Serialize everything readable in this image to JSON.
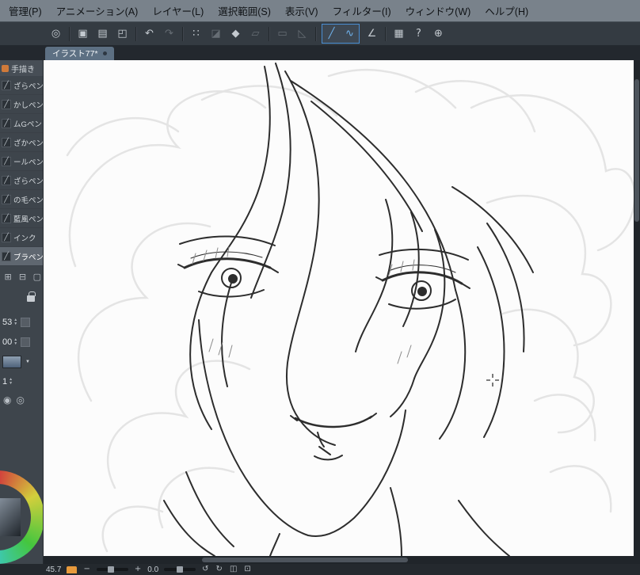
{
  "menu": {
    "items": [
      {
        "label": "管理(P)"
      },
      {
        "label": "アニメーション(A)"
      },
      {
        "label": "レイヤー(L)"
      },
      {
        "label": "選択範囲(S)"
      },
      {
        "label": "表示(V)"
      },
      {
        "label": "フィルター(I)"
      },
      {
        "label": "ウィンドウ(W)"
      },
      {
        "label": "ヘルプ(H)"
      }
    ]
  },
  "toolbar": {
    "icons": [
      {
        "name": "navigate-icon",
        "glyph": "◎",
        "state": "normal"
      },
      {
        "name": "new-file-icon",
        "glyph": "▣",
        "state": "normal"
      },
      {
        "name": "open-file-icon",
        "glyph": "▤",
        "state": "normal"
      },
      {
        "name": "save-icon",
        "glyph": "◰",
        "state": "normal"
      },
      {
        "name": "undo-icon",
        "glyph": "↶",
        "state": "normal"
      },
      {
        "name": "redo-icon",
        "glyph": "↷",
        "state": "disabled"
      },
      {
        "name": "spray-icon",
        "glyph": "∷",
        "state": "normal"
      },
      {
        "name": "gradient-icon",
        "glyph": "◪",
        "state": "disabled"
      },
      {
        "name": "blend-icon",
        "glyph": "◆",
        "state": "normal"
      },
      {
        "name": "frame-icon",
        "glyph": "▱",
        "state": "disabled"
      },
      {
        "name": "rect-select-icon",
        "glyph": "▭",
        "state": "disabled"
      },
      {
        "name": "lasso-select-icon",
        "glyph": "◺",
        "state": "disabled"
      },
      {
        "name": "line-tool-icon",
        "glyph": "╱",
        "state": "selected"
      },
      {
        "name": "curve-tool-icon",
        "glyph": "∿",
        "state": "selected"
      },
      {
        "name": "perspective-icon",
        "glyph": "∠",
        "state": "normal"
      },
      {
        "name": "shortcut-keyboard-icon",
        "glyph": "▦",
        "state": "normal"
      },
      {
        "name": "help-icon",
        "glyph": "?",
        "state": "normal"
      },
      {
        "name": "preferences-icon",
        "glyph": "⊕",
        "state": "normal"
      }
    ]
  },
  "tab": {
    "label": "イラスト77*"
  },
  "subtool": {
    "header": {
      "label": "手描き"
    },
    "items": [
      {
        "label": "ざらペン"
      },
      {
        "label": "かしペン"
      },
      {
        "label": "ムGペン"
      },
      {
        "label": "ざかペン"
      },
      {
        "label": "ールペン"
      },
      {
        "label": "ざらペン"
      },
      {
        "label": "の毛ペン"
      },
      {
        "label": "藍風ペン"
      },
      {
        "label": "インク"
      },
      {
        "label": "ブラペン"
      }
    ],
    "selected": "ブラペン",
    "actions": [
      {
        "name": "add-subtool-icon",
        "glyph": "⊞"
      },
      {
        "name": "duplicate-subtool-icon",
        "glyph": "⊟"
      },
      {
        "name": "delete-subtool-icon",
        "glyph": "▢"
      }
    ]
  },
  "tool_property": {
    "size_value": "53",
    "opacity_value": "00",
    "count_value": "1",
    "icons": [
      {
        "name": "stabilize-icon",
        "glyph": "◉"
      },
      {
        "name": "magnify-icon",
        "glyph": "◎"
      }
    ]
  },
  "statusbar": {
    "zoom_value": "45.7",
    "zoom_out": "−",
    "zoom_in": "+",
    "angle_value": "0.0",
    "icons": [
      {
        "name": "rotate-ccw-icon",
        "glyph": "↺"
      },
      {
        "name": "rotate-cw-icon",
        "glyph": "↻"
      },
      {
        "name": "flip-icon",
        "glyph": "◫"
      },
      {
        "name": "fit-screen-icon",
        "glyph": "⊡"
      }
    ]
  },
  "ui": {
    "spinner_up": "▲",
    "spinner_down": "▼",
    "dropdown": "▼",
    "pen_glyph": "╱"
  },
  "colors": {
    "accent_blue": "#4a8fd4",
    "panel": "#3d444b",
    "canvas": "#fcfcfc"
  }
}
